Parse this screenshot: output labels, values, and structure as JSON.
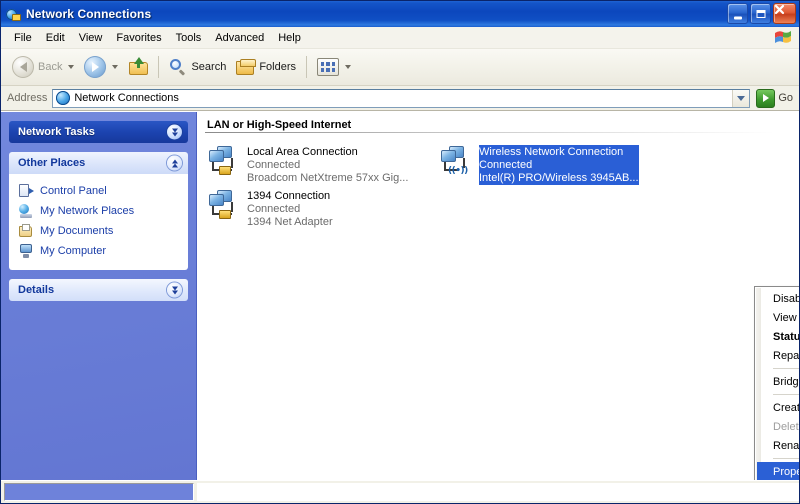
{
  "window": {
    "title": "Network Connections",
    "title_icon": "network-globe-icon",
    "buttons": {
      "minimize": "minimize-button",
      "maximize": "maximize-button",
      "close": "close-button"
    }
  },
  "menubar": {
    "items": [
      {
        "label": "File"
      },
      {
        "label": "Edit"
      },
      {
        "label": "View"
      },
      {
        "label": "Favorites"
      },
      {
        "label": "Tools"
      },
      {
        "label": "Advanced"
      },
      {
        "label": "Help"
      }
    ]
  },
  "toolbar": {
    "back_label": "Back",
    "search_label": "Search",
    "folders_label": "Folders",
    "views_icon": "views-grid-icon"
  },
  "address": {
    "label": "Address",
    "value": "Network Connections",
    "go_label": "Go"
  },
  "sidebar": {
    "panels": [
      {
        "title": "Network Tasks",
        "state": "collapsed",
        "items": []
      },
      {
        "title": "Other Places",
        "state": "expanded",
        "items": [
          {
            "label": "Control Panel",
            "icon": "control-panel-icon"
          },
          {
            "label": "My Network Places",
            "icon": "network-places-icon"
          },
          {
            "label": "My Documents",
            "icon": "my-documents-icon"
          },
          {
            "label": "My Computer",
            "icon": "my-computer-icon"
          }
        ]
      },
      {
        "title": "Details",
        "state": "collapsed",
        "items": []
      }
    ]
  },
  "content": {
    "group_header": "LAN or High-Speed Internet",
    "connections": [
      {
        "name": "Local Area Connection",
        "status": "Connected",
        "device": "Broadcom NetXtreme 57xx Gig...",
        "icon": "lan-connection-icon",
        "selected": false
      },
      {
        "name": "Wireless Network Connection",
        "status": "Connected",
        "device": "Intel(R) PRO/Wireless 3945AB...",
        "icon": "wireless-connection-icon",
        "selected": true
      },
      {
        "name": "1394 Connection",
        "status": "Connected",
        "device": "1394 Net Adapter",
        "icon": "lan-connection-icon",
        "selected": false
      }
    ]
  },
  "context_menu": {
    "items": [
      {
        "label": "Disable",
        "state": "normal"
      },
      {
        "label": "View Available Wireless Networks",
        "state": "normal"
      },
      {
        "label": "Status",
        "state": "bold"
      },
      {
        "label": "Repair",
        "state": "normal"
      },
      {
        "separator_after": true
      },
      {
        "label": "Bridge Connections",
        "state": "normal"
      },
      {
        "separator_after": true
      },
      {
        "label": "Create Shortcut",
        "state": "normal"
      },
      {
        "label": "Delete",
        "state": "disabled"
      },
      {
        "label": "Rename",
        "state": "normal"
      },
      {
        "separator_after": true
      },
      {
        "label": "Properties",
        "state": "highlight"
      }
    ]
  },
  "statusbar": {
    "text": ""
  },
  "colors": {
    "title_blue": "#0c47bd",
    "sidebar_blue": "#6376d2",
    "panel_header_dark": "#1c44b0",
    "selection_blue": "#2a5fd6",
    "menu_highlight": "#2b60d5",
    "link_blue": "#1b3ea8",
    "toolbar_bg": "#f2f1e8"
  }
}
